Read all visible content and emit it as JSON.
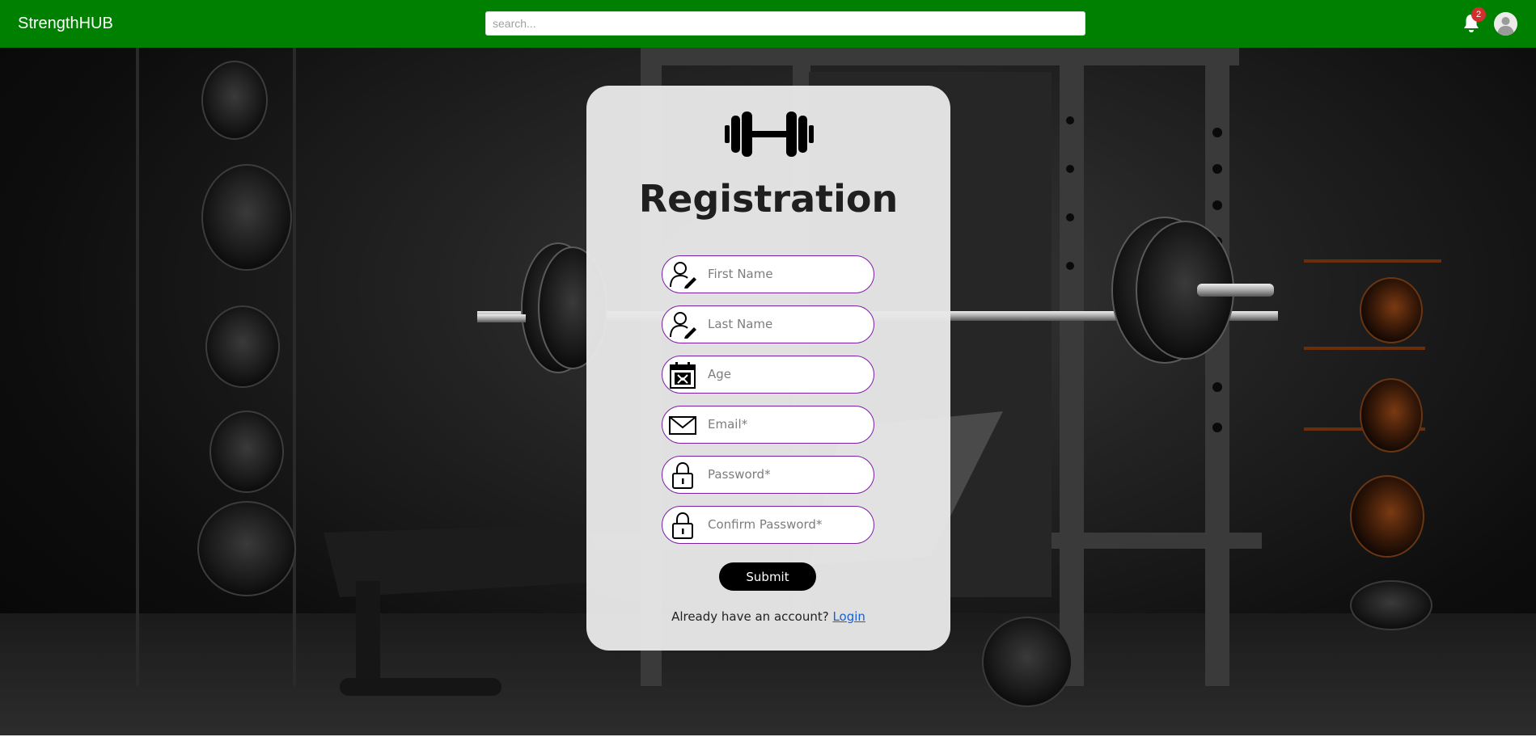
{
  "navbar": {
    "brand": "StrengthHUB",
    "search_placeholder": "search...",
    "notification_count": "2",
    "bell_icon": "bell-icon",
    "avatar_icon": "user-avatar-icon"
  },
  "colors": {
    "navbar_bg": "#008000",
    "field_border": "#7a1fa2",
    "submit_bg": "#000000",
    "link": "#1a5fd0",
    "badge": "#d32f2f"
  },
  "form": {
    "logo_icon": "dumbbell-icon",
    "title": "Registration",
    "fields": [
      {
        "placeholder": "First Name",
        "icon": "user-edit-icon",
        "type": "text"
      },
      {
        "placeholder": "Last Name",
        "icon": "user-edit-icon",
        "type": "text"
      },
      {
        "placeholder": "Age",
        "icon": "calendar-icon",
        "type": "text"
      },
      {
        "placeholder": "Email*",
        "icon": "envelope-icon",
        "type": "email"
      },
      {
        "placeholder": "Password*",
        "icon": "lock-icon",
        "type": "password"
      },
      {
        "placeholder": "Confirm Password*",
        "icon": "lock-icon",
        "type": "password"
      }
    ],
    "submit_label": "Submit",
    "login_prompt": "Already have an account?",
    "login_link": "Login"
  }
}
